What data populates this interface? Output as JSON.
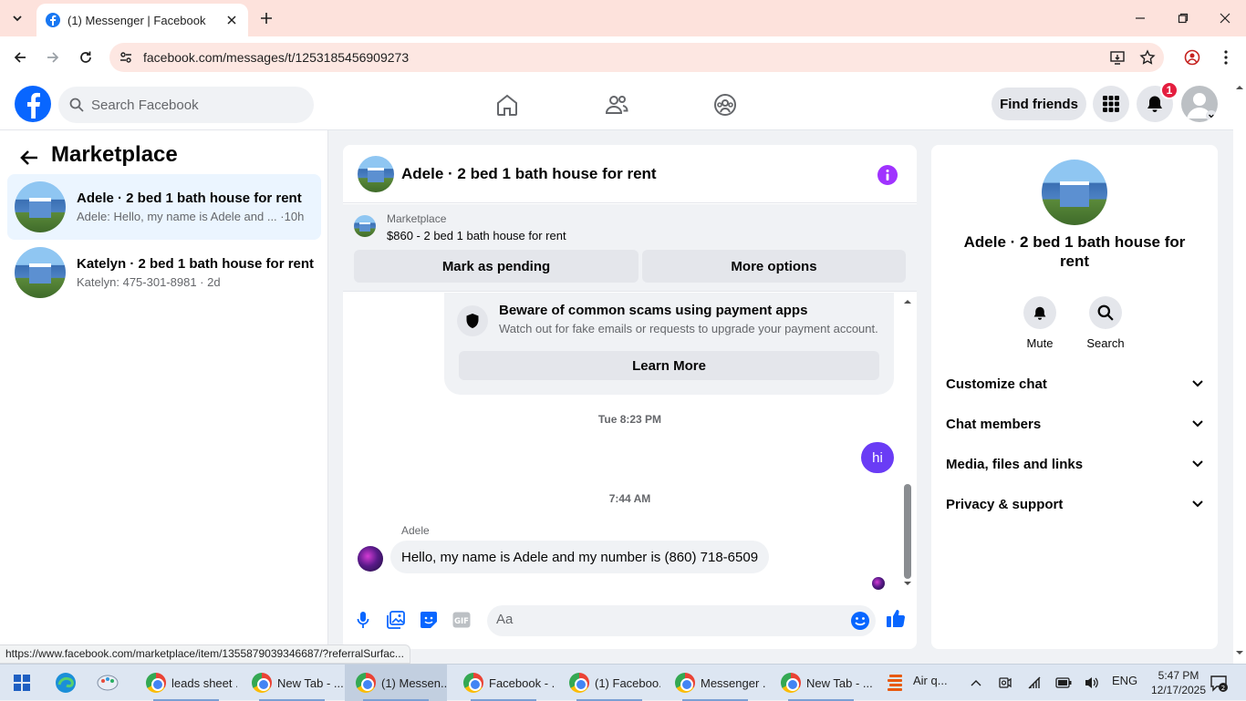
{
  "browser": {
    "tab_title": "(1) Messenger | Facebook",
    "url": "facebook.com/messages/t/1253185456909273",
    "status_url": "https://www.facebook.com/marketplace/item/1355879039346687/?referralSurfac..."
  },
  "fb_header": {
    "search_placeholder": "Search Facebook",
    "find_friends": "Find friends",
    "notification_count": "1"
  },
  "sidebar": {
    "title": "Marketplace",
    "conversations": [
      {
        "title": "Adele · 2 bed 1 bath house for rent",
        "preview": "Adele: Hello, my name is Adele and ... ·10h"
      },
      {
        "title": "Katelyn · 2 bed 1 bath house for rent",
        "preview": "Katelyn: 475-301-8981 · 2d"
      }
    ]
  },
  "chat": {
    "title": "Adele · 2 bed 1 bath house for rent",
    "marketplace_label": "Marketplace",
    "listing": "$860 - 2 bed 1 bath house for rent",
    "mark_pending": "Mark as pending",
    "more_options": "More options",
    "scam_title": "Beware of common scams using payment apps",
    "scam_desc": "Watch out for fake emails or requests to upgrade your payment account.",
    "learn_more": "Learn More",
    "ts1": "Tue 8:23 PM",
    "my_msg": "hi",
    "ts2": "7:44 AM",
    "sender": "Adele",
    "other_msg": "Hello, my name is Adele and my number is (860) 718-6509",
    "input_placeholder": "Aa"
  },
  "details": {
    "name": "Adele · 2 bed 1 bath house for rent",
    "mute": "Mute",
    "search": "Search",
    "rows": [
      "Customize chat",
      "Chat members",
      "Media, files and links",
      "Privacy & support"
    ]
  },
  "taskbar": {
    "items": [
      "leads sheet ...",
      "New Tab - ...",
      "(1) Messen...",
      "Facebook - ...",
      "(1) Faceboo...",
      "Messenger ...",
      "New Tab - ..."
    ],
    "weather": "Air q...",
    "lang": "ENG",
    "time": "5:47 PM",
    "date": "12/17/2025"
  }
}
